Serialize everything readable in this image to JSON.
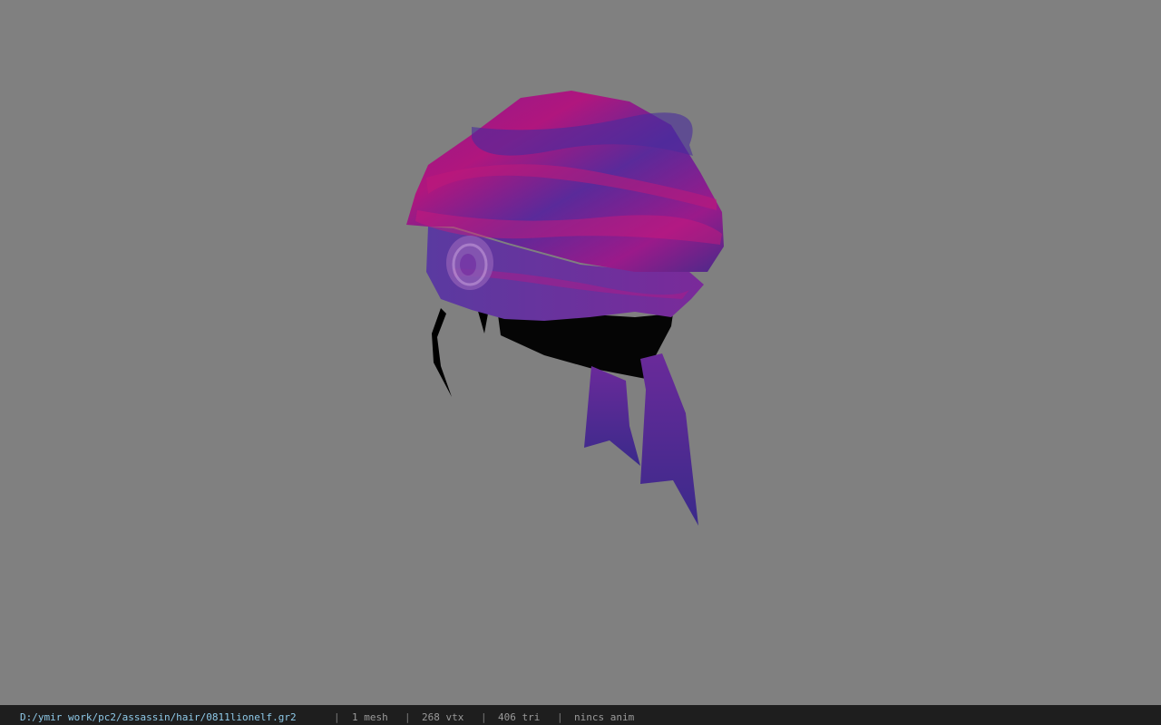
{
  "viewport": {
    "background_color": "#808080",
    "model_icon": "bandana-hair-model"
  },
  "status_bar": {
    "file_path": "D:/ymir work/pc2/assassin/hair/0811lionelf.gr2",
    "separator": "|",
    "mesh_count": "1 mesh",
    "vertex_count": "268 vtx",
    "triangle_count": "406 tri",
    "animation": "nincs anim",
    "path_color": "#8ec9e8",
    "text_color": "#9a9a9a",
    "background_color": "#1e1e1e"
  }
}
